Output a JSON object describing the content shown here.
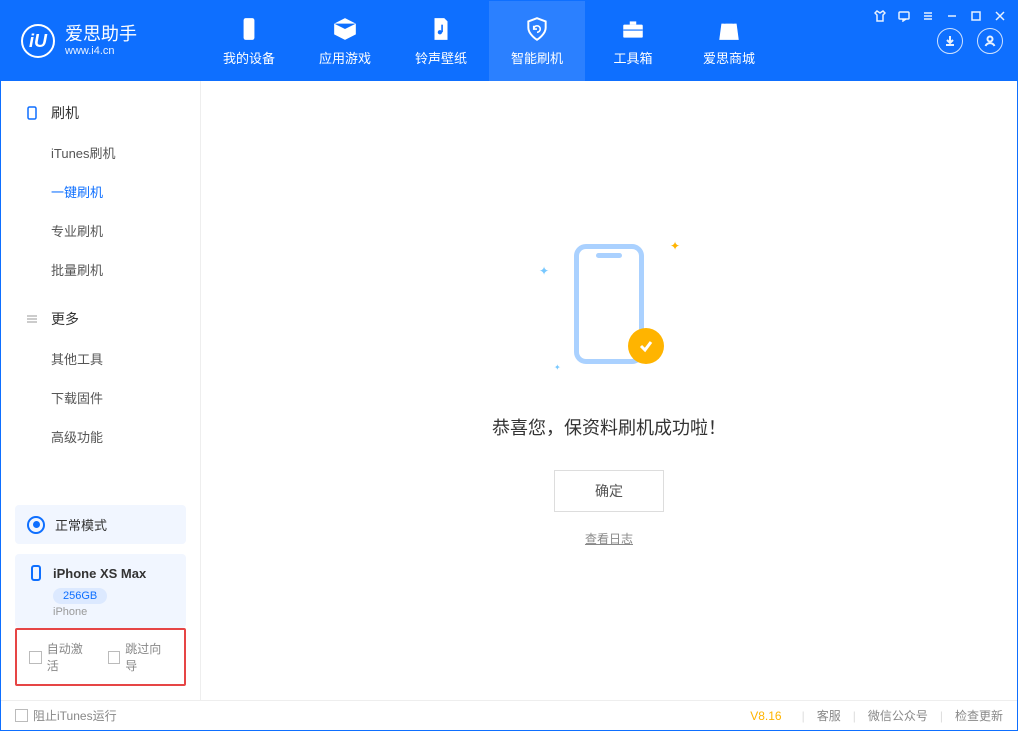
{
  "app": {
    "name_cn": "爱思助手",
    "url": "www.i4.cn"
  },
  "nav": {
    "my_device": "我的设备",
    "apps_games": "应用游戏",
    "ringtones": "铃声壁纸",
    "smart_flash": "智能刷机",
    "toolbox": "工具箱",
    "store": "爱思商城"
  },
  "sidebar": {
    "flash_header": "刷机",
    "items_flash": {
      "itunes": "iTunes刷机",
      "oneclick": "一键刷机",
      "pro": "专业刷机",
      "batch": "批量刷机"
    },
    "more_header": "更多",
    "items_more": {
      "other_tools": "其他工具",
      "download_fw": "下载固件",
      "advanced": "高级功能"
    }
  },
  "mode": {
    "label": "正常模式"
  },
  "device": {
    "name": "iPhone XS Max",
    "storage": "256GB",
    "type": "iPhone"
  },
  "opts": {
    "auto_activate": "自动激活",
    "skip_guide": "跳过向导"
  },
  "main": {
    "success": "恭喜您，保资料刷机成功啦！",
    "ok": "确定",
    "view_log": "查看日志"
  },
  "footer": {
    "block_itunes": "阻止iTunes运行",
    "version": "V8.16",
    "support": "客服",
    "wechat": "微信公众号",
    "update": "检查更新"
  }
}
